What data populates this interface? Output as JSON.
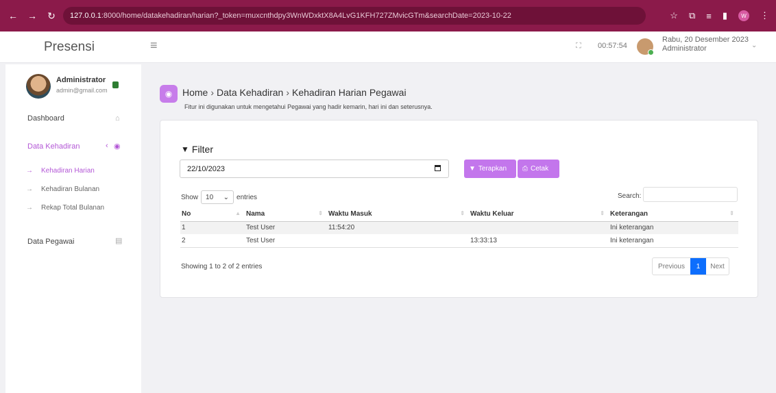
{
  "browser": {
    "url_host": "127.0.0.1",
    "url_rest": ":8000/home/datakehadiran/harian?_token=muxcnthdpy3WnWDxktX8A4LvG1KFH727ZMvicGTm&searchDate=2023-10-22",
    "profile_initial": "W",
    "accent_color": "#8b1a4a"
  },
  "topbar": {
    "brand": "Presensi",
    "clock": "00:57:54",
    "date": "Rabu, 20 Desember 2023",
    "role": "Administrator"
  },
  "sidebar": {
    "user_name": "Administrator",
    "user_email": "admin@gmail.com",
    "dashboard": "Dashboard",
    "attendance": "Data Kehadiran",
    "attendance_sub": [
      "Kehadiran Harian",
      "Kehadiran Bulanan",
      "Rekap Total Bulanan"
    ],
    "employees": "Data Pegawai",
    "accent_color": "#b357d6"
  },
  "header": {
    "breadcrumb": [
      "Home",
      "Data Kehadiran",
      "Kehadiran Harian Pegawai"
    ],
    "subtitle": "Fitur ini digunakan untuk mengetahui Pegawai yang hadir kemarin, hari ini dan seterusnya."
  },
  "filter": {
    "title": "Filter",
    "date_value": "22/10/2023",
    "apply_label": "Terapkan",
    "print_label": "Cetak"
  },
  "table": {
    "show": "Show",
    "page_size": "10",
    "entries": "entries",
    "search_label": "Search:",
    "columns": [
      "No",
      "Nama",
      "Waktu Masuk",
      "Waktu Keluar",
      "Keterangan"
    ],
    "rows": [
      [
        "1",
        "Test User",
        "11:54:20",
        "",
        "Ini keterangan"
      ],
      [
        "2",
        "Test User",
        "",
        "13:33:13",
        "Ini keterangan"
      ]
    ],
    "info": "Showing 1 to 2 of 2 entries",
    "prev": "Previous",
    "page": "1",
    "next": "Next"
  }
}
